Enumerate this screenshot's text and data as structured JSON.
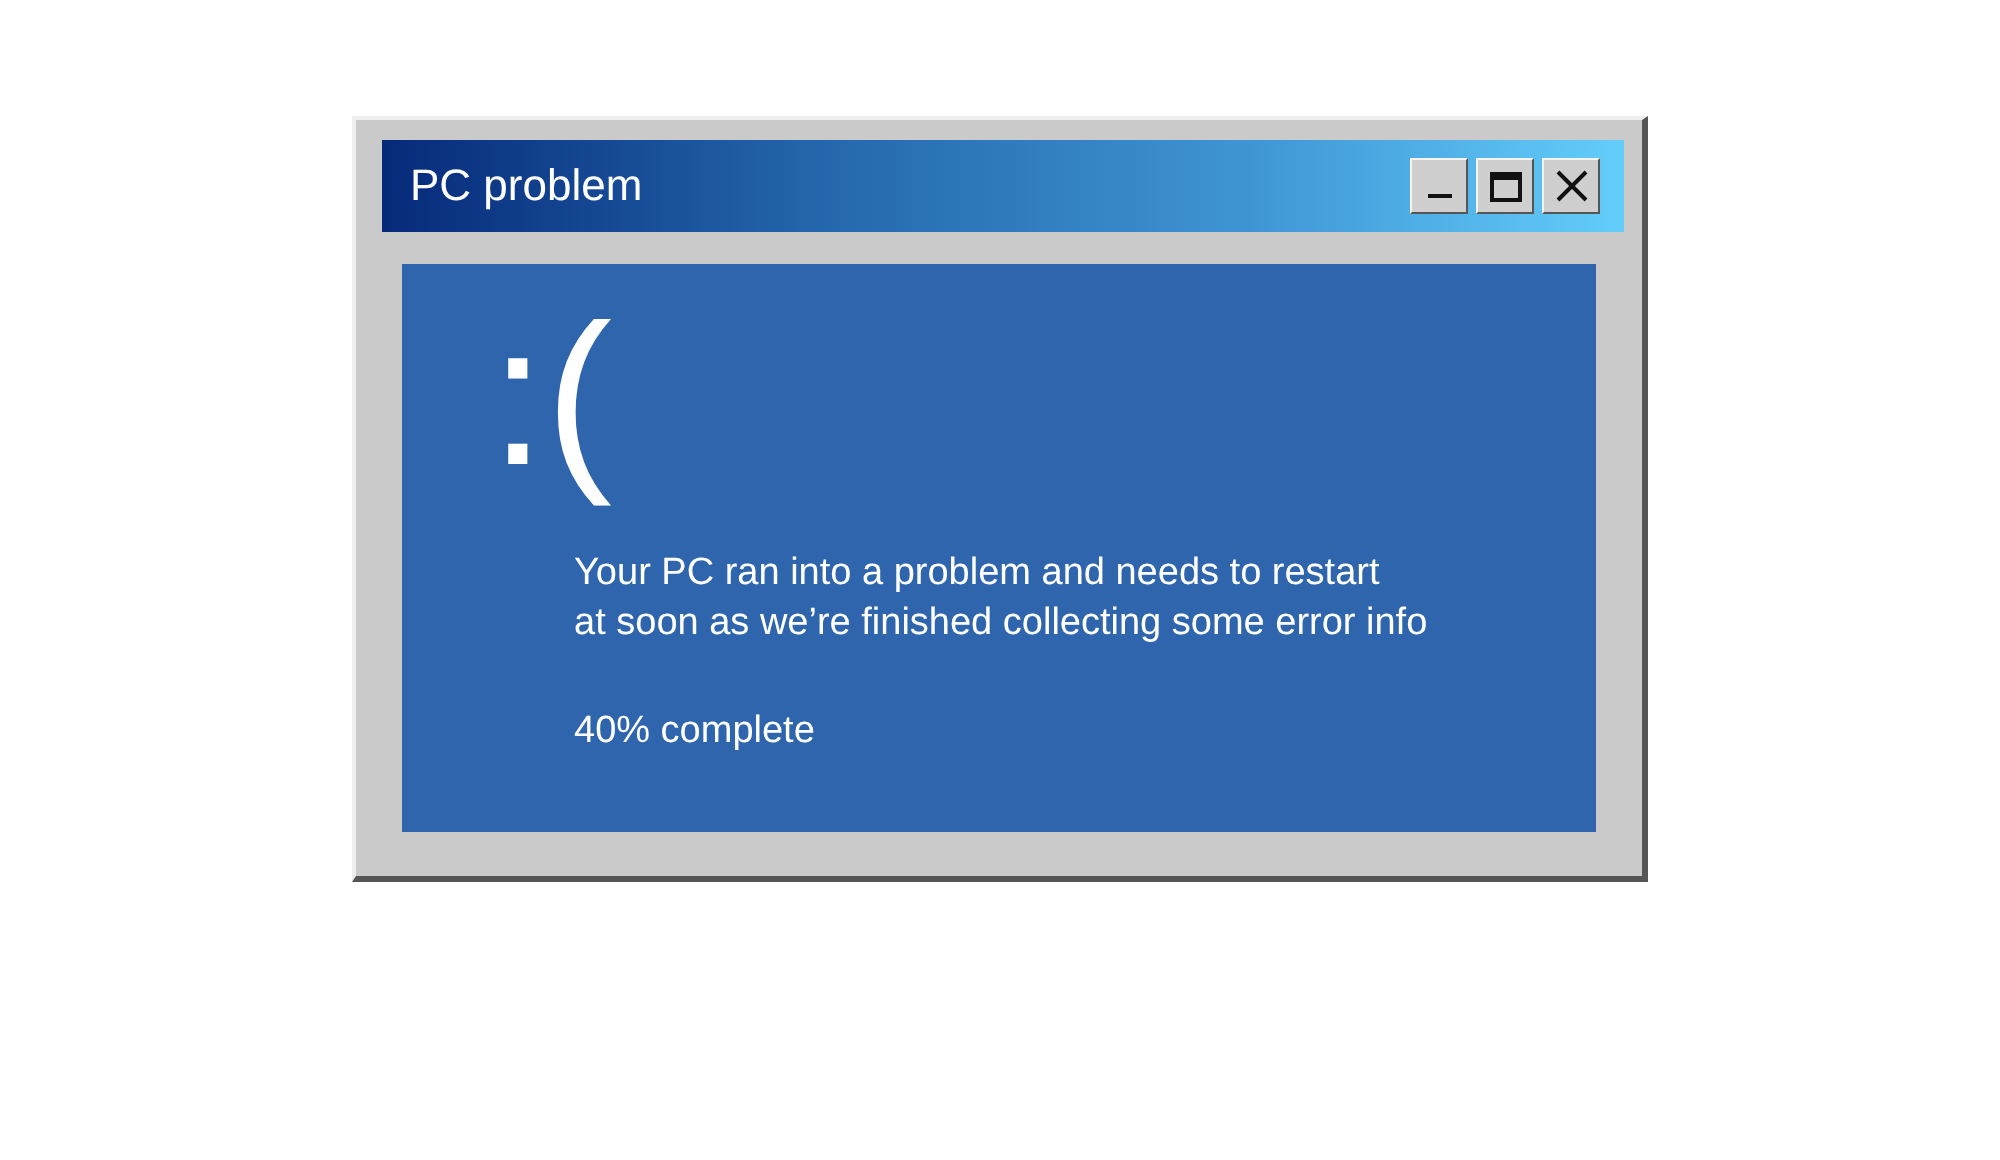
{
  "window": {
    "title": "PC problem",
    "controls": [
      {
        "kind": "minimize"
      },
      {
        "kind": "maximize"
      },
      {
        "kind": "close"
      }
    ]
  },
  "screen": {
    "face": ":(",
    "message": [
      "Your PC ran into a problem and needs to restart",
      "at soon as we’re finished collecting some error info"
    ],
    "progress": "40% complete"
  }
}
